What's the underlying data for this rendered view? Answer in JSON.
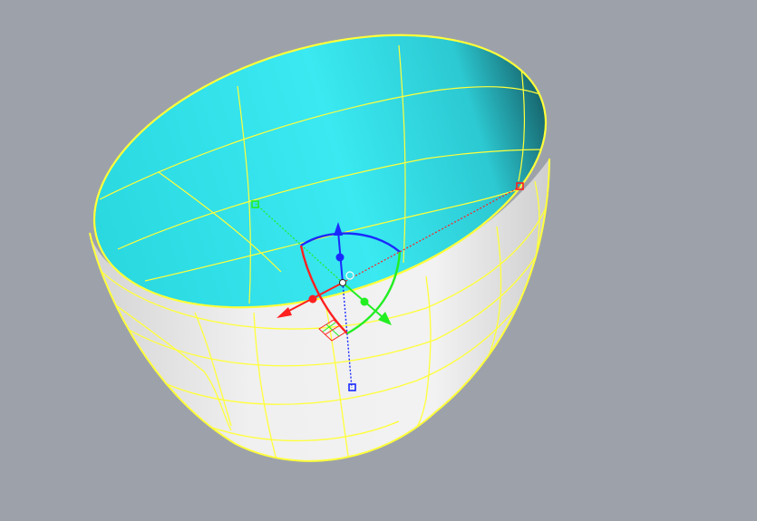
{
  "viewport": {
    "background": "#9da2aa",
    "display_mode": "shaded"
  },
  "object": {
    "kind": "half-ellipsoid-shell",
    "selected": true,
    "inner_color": "#36e6ee",
    "outer_color": "#ececec",
    "isocurve_color": "#ffff3a"
  },
  "gizmo": {
    "type": "gumball",
    "x_axis_color": "#ff2020",
    "y_axis_color": "#22ee22",
    "z_axis_color": "#1a2aff"
  }
}
